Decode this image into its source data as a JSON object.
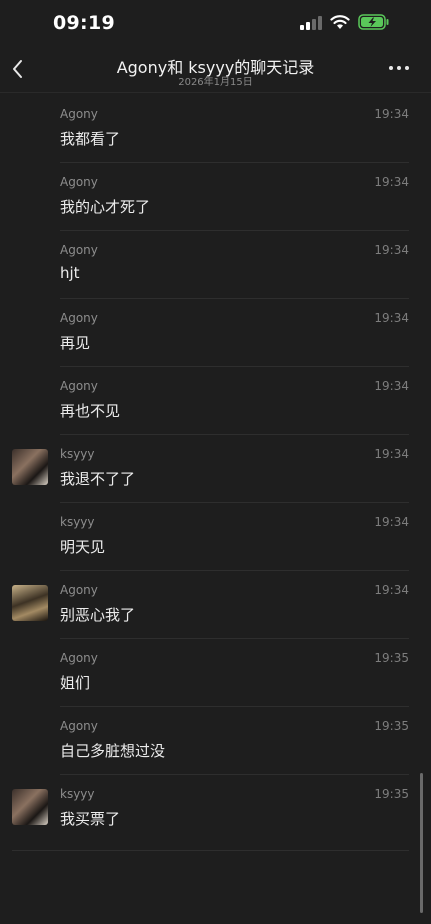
{
  "status": {
    "time": "09:19"
  },
  "nav": {
    "title": "Agony和 ksyyy的聊天记录",
    "subtitle": "2026年1月15日"
  },
  "messages": [
    {
      "sender": "Agony",
      "time": "19:34",
      "text": "我都看了",
      "avatar": ""
    },
    {
      "sender": "Agony",
      "time": "19:34",
      "text": "我的心才死了",
      "avatar": ""
    },
    {
      "sender": "Agony",
      "time": "19:34",
      "text": "hjt",
      "avatar": ""
    },
    {
      "sender": "Agony",
      "time": "19:34",
      "text": "再见",
      "avatar": ""
    },
    {
      "sender": "Agony",
      "time": "19:34",
      "text": "再也不见",
      "avatar": ""
    },
    {
      "sender": "ksyyy",
      "time": "19:34",
      "text": "我退不了了",
      "avatar": "a"
    },
    {
      "sender": "ksyyy",
      "time": "19:34",
      "text": "明天见",
      "avatar": ""
    },
    {
      "sender": "Agony",
      "time": "19:34",
      "text": "别恶心我了",
      "avatar": "b"
    },
    {
      "sender": "Agony",
      "time": "19:35",
      "text": "姐们",
      "avatar": ""
    },
    {
      "sender": "Agony",
      "time": "19:35",
      "text": "自己多脏想过没",
      "avatar": ""
    },
    {
      "sender": "ksyyy",
      "time": "19:35",
      "text": "我买票了",
      "avatar": "a"
    }
  ]
}
